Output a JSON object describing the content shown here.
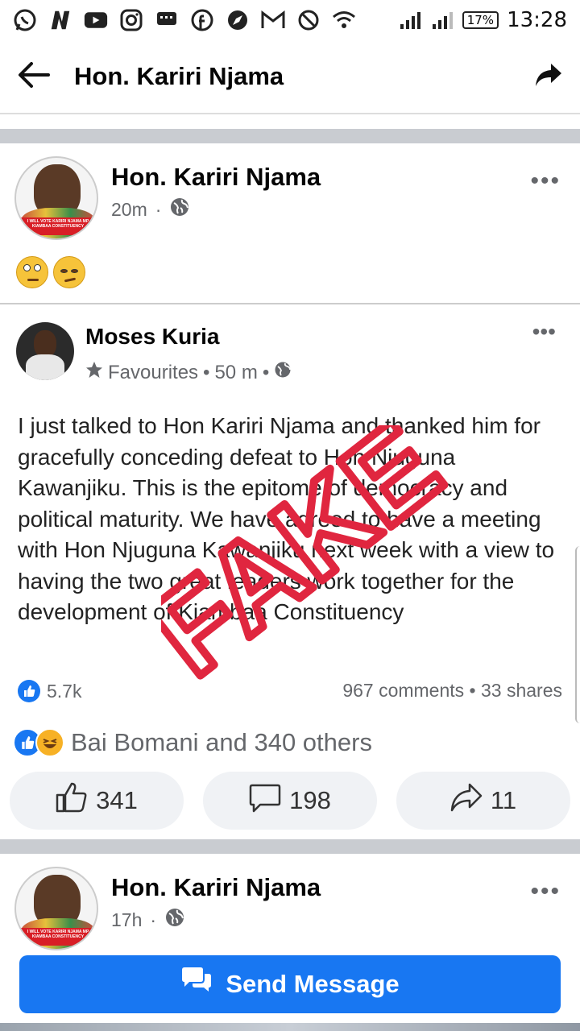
{
  "status_bar": {
    "battery": "17%",
    "time": "13:28"
  },
  "header": {
    "title": "Hon. Kariri Njama"
  },
  "post": {
    "author": "Hon. Kariri Njama",
    "time": "20m",
    "separator": "·",
    "avatar_banner": "I WILL VOTE KARIRI NJAMA MP KIAMBAA CONSTITUENCY"
  },
  "shared": {
    "author": "Moses Kuria",
    "meta_favourites": "Favourites",
    "meta_time": "50 m",
    "dot": "•",
    "text": "I just talked to Hon Kariri Njama and thanked him for gracefully conceding defeat to Hon Njuguna Kawanjiku. This is the epitome of democracy and political maturity. We have agreed to have a meeting with Hon Njuguna Kawanjiku next week with a view to having the two great leaders work together for the development of Kiambaa Constituency",
    "stamp": "FAKE",
    "likes": "5.7k",
    "stats": "967 comments • 33 shares"
  },
  "reactions": {
    "summary": "Bai Bomani and 340 others"
  },
  "actions": {
    "like_count": "341",
    "comment_count": "198",
    "share_count": "11"
  },
  "next_post": {
    "author": "Hon. Kariri Njama",
    "time": "17h",
    "separator": "·"
  },
  "cta": {
    "label": "Send Message"
  },
  "colors": {
    "brand_blue": "#1877f2",
    "stamp_red": "#e0263f",
    "muted_text": "#65676b"
  }
}
